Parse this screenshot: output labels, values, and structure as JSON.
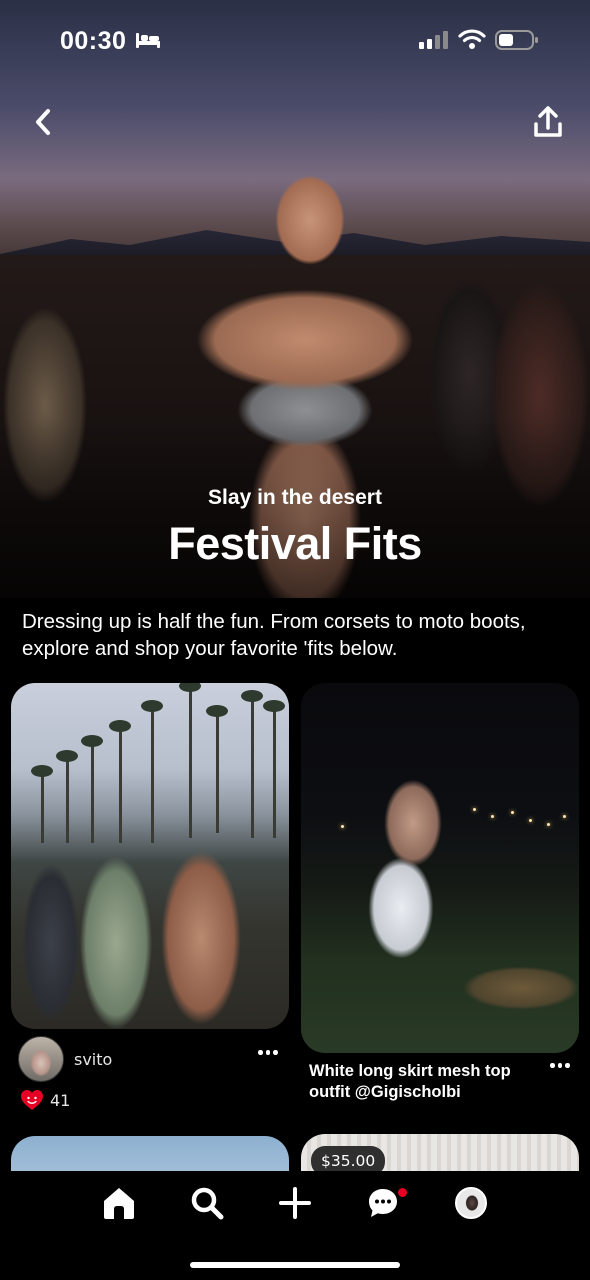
{
  "status_bar": {
    "time": "00:30",
    "icons": [
      "bed-icon",
      "cellular-signal-icon",
      "wifi-icon",
      "battery-icon"
    ]
  },
  "header": {
    "back_icon": "chevron-left-icon",
    "share_icon": "share-icon"
  },
  "hero": {
    "kicker": "Slay in the desert",
    "title": "Festival Fits"
  },
  "description": "Dressing up is half the fun. From corsets to moto boots, explore and shop your favorite 'fits below.",
  "pins": [
    {
      "author": "svito",
      "likes": "41",
      "more_icon": "more-horizontal-icon",
      "like_icon": "heart-icon"
    },
    {
      "title": "White long skirt mesh top outfit @Gigischolbi",
      "more_icon": "more-horizontal-icon"
    },
    {},
    {
      "price": "$35.00"
    }
  ],
  "bottom_nav": {
    "items": [
      "home-icon",
      "search-icon",
      "plus-icon",
      "chat-bubble-icon",
      "profile-avatar"
    ],
    "has_notification": true
  },
  "colors": {
    "background": "#000000",
    "text": "#ffffff",
    "like_red": "#e60023",
    "notification": "#e60023"
  }
}
